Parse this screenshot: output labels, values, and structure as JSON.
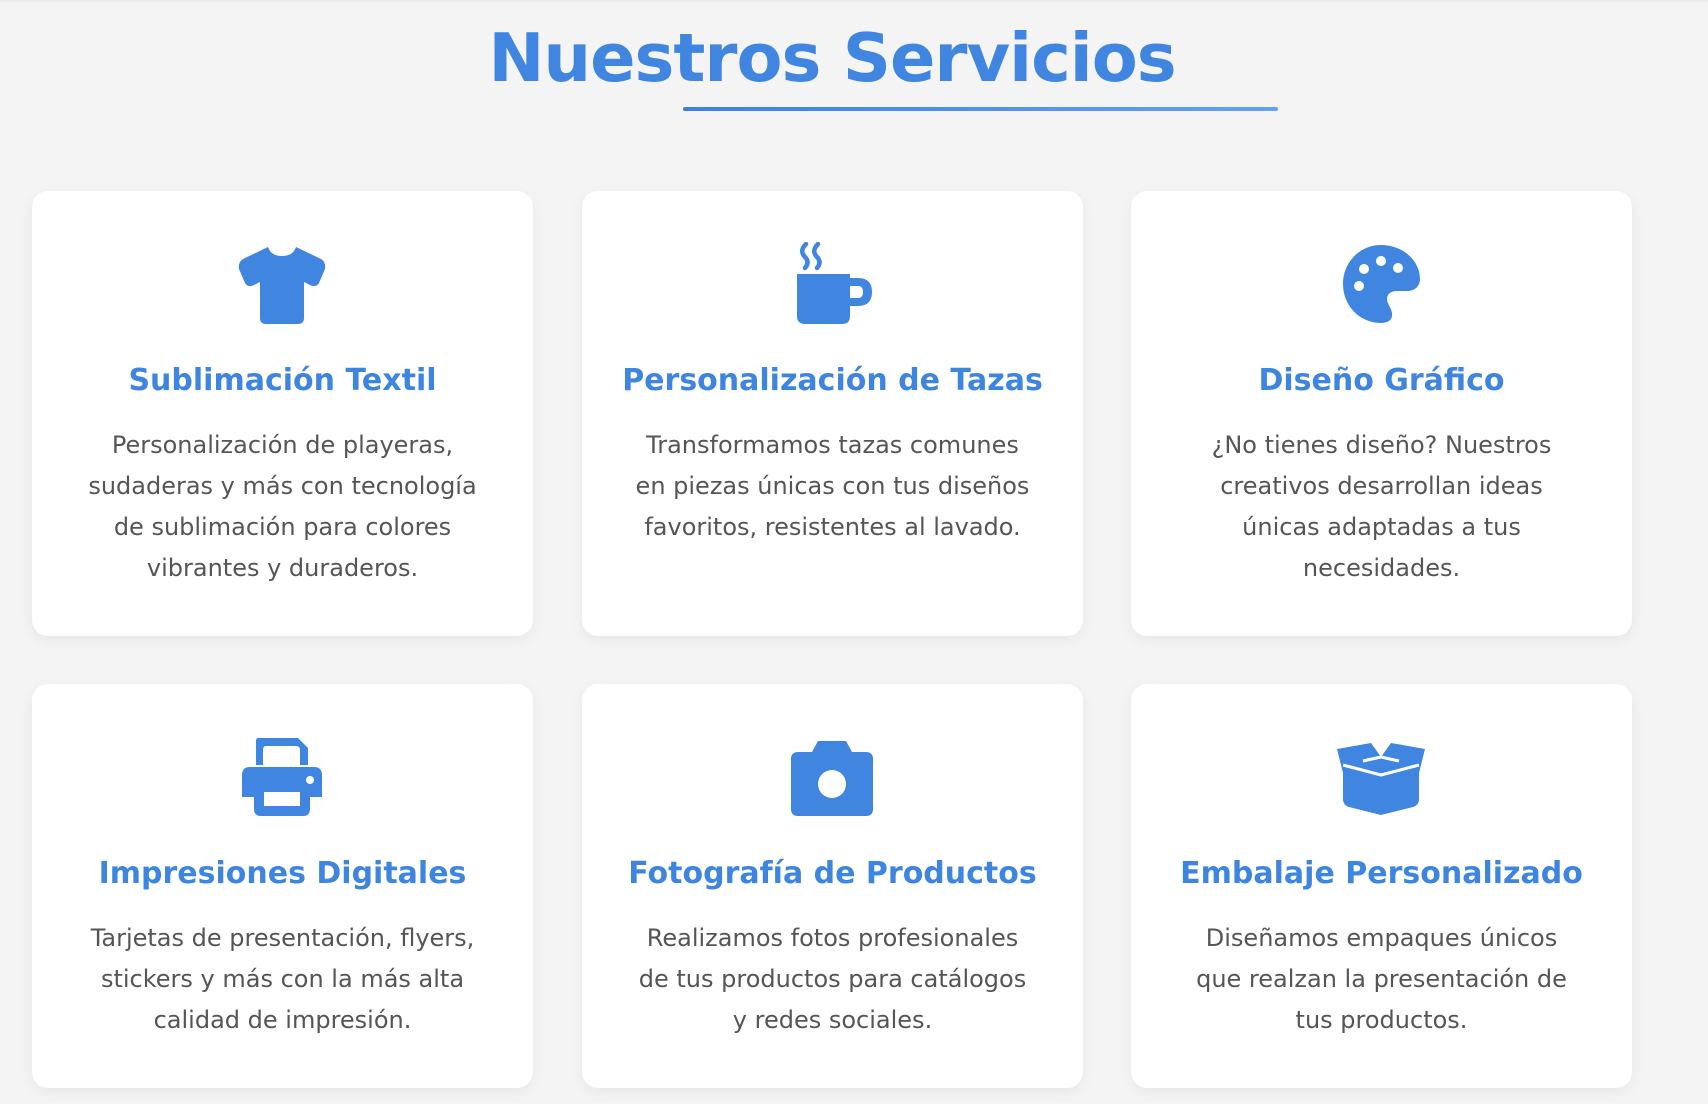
{
  "section": {
    "title": "Nuestros Servicios"
  },
  "colors": {
    "accent": "#4086e0",
    "background": "#f4f4f5",
    "card": "#ffffff",
    "text": "#555555"
  },
  "services": [
    {
      "icon": "tshirt-icon",
      "title": "Sublimación Textil",
      "description": "Personalización de playeras, sudaderas y más con tecnología de sublimación para colores vibrantes y duraderos."
    },
    {
      "icon": "mug-hot-icon",
      "title": "Personalización de Tazas",
      "description": "Transformamos tazas comunes en piezas únicas con tus diseños favoritos, resistentes al lavado."
    },
    {
      "icon": "palette-icon",
      "title": "Diseño Gráfico",
      "description": "¿No tienes diseño? Nuestros creativos desarrollan ideas únicas adaptadas a tus necesidades."
    },
    {
      "icon": "printer-icon",
      "title": "Impresiones Digitales",
      "description": "Tarjetas de presentación, flyers, stickers y más con la más alta calidad de impresión."
    },
    {
      "icon": "camera-icon",
      "title": "Fotografía de Productos",
      "description": "Realizamos fotos profesionales de tus productos para catálogos y redes sociales."
    },
    {
      "icon": "box-open-icon",
      "title": "Embalaje Personalizado",
      "description": "Diseñamos empaques únicos que realzan la presentación de tus productos."
    }
  ]
}
